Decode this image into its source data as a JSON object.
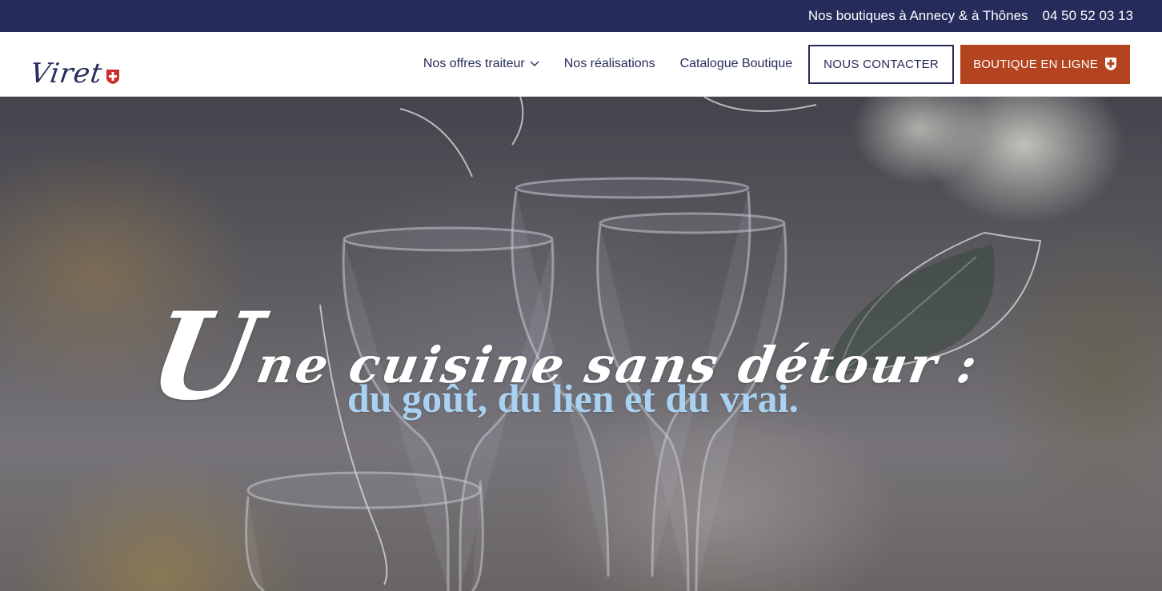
{
  "topbar": {
    "shops": "Nos boutiques à Annecy & à Thônes",
    "phone": "04 50 52 03 13"
  },
  "header": {
    "logo_text": "Viret",
    "nav": [
      {
        "label": "Nos offres traiteur",
        "icon": "chevron-down-icon"
      },
      {
        "label": "Nos réalisations"
      },
      {
        "label": "Catalogue Boutique"
      }
    ],
    "contact_button": "NOUS CONTACTER",
    "shop_button": "BOUTIQUE EN LIGNE",
    "shop_button_icon": "savoie-cross-icon"
  },
  "hero": {
    "title_initial": "U",
    "title_rest": "ne cuisine sans détour :",
    "subtitle": "du goût, du lien et du vrai."
  },
  "colors": {
    "navy": "#252c5c",
    "accent": "#b4441f",
    "subtitle": "#a9d1f2"
  }
}
